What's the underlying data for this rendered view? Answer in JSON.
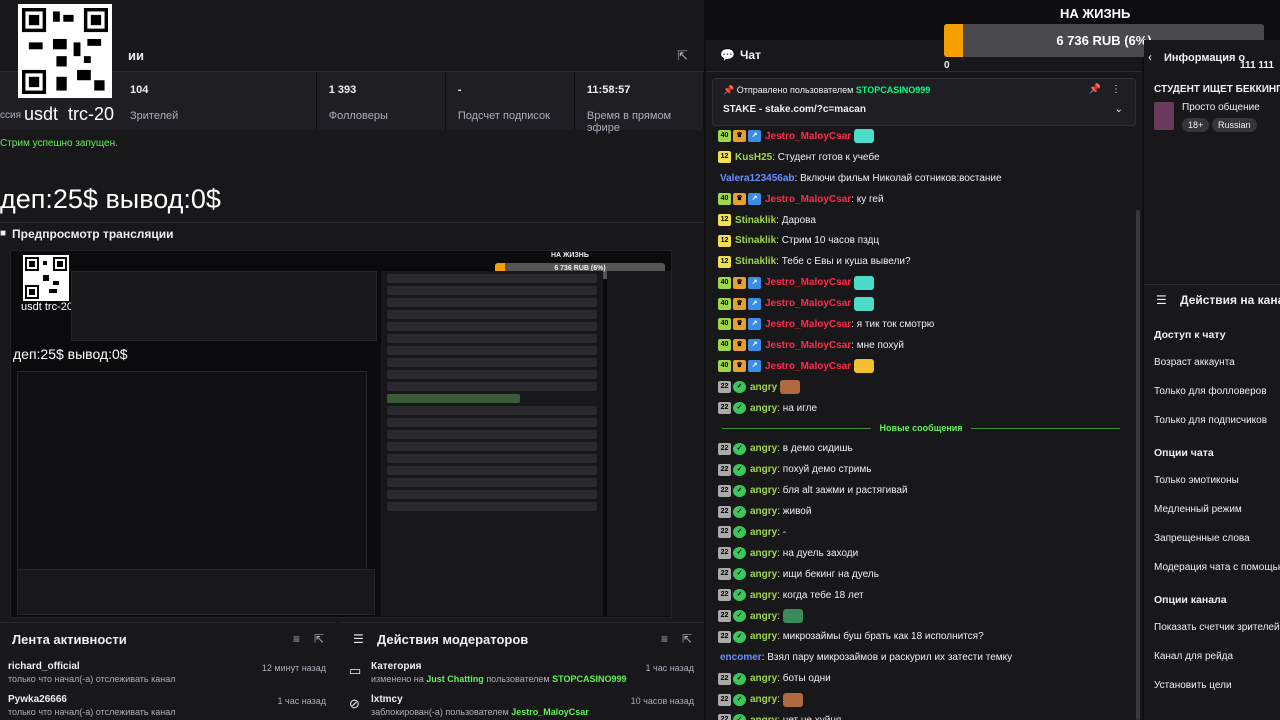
{
  "qr_caption": {
    "left": "usdt",
    "right": "trc-20"
  },
  "stats_header": {
    "title": "ии"
  },
  "stats": [
    {
      "value": "104",
      "label": "Зрителей"
    },
    {
      "value": "1 393",
      "label": "Фолловеры"
    },
    {
      "value": "-",
      "label": "Подсчет подписок"
    },
    {
      "value": "11:58:57",
      "label": "Время в прямом эфире"
    }
  ],
  "status_text": "Стрим успешно запущен.",
  "status_prefix": "ссия",
  "dep_text": "деп:25$ вывод:0$",
  "preview": {
    "title": "Предпросмотр трансляции",
    "goal_title": "НА ЖИЗНЬ",
    "goal_label": "6 736 RUB (6%)",
    "dep_text": "деп:25$ вывод:0$",
    "caption": "usdt  trc-20"
  },
  "activity": {
    "title": "Лента активности",
    "items": [
      {
        "name": "richard_official",
        "desc": "только что начал(-а) отслеживать канал",
        "time": "12 минут назад"
      },
      {
        "name": "Pywka26666",
        "desc": "только что начал(-а) отслеживать канал",
        "time": "1 час назад"
      }
    ]
  },
  "mod_actions_panel": {
    "title": "Действия модераторов",
    "items": [
      {
        "name": "Категория",
        "desc_prefix": "изменено на",
        "category": "Just Chatting",
        "desc_mid": "пользователем",
        "user": "STOPCASINO999",
        "time": "1 час назад"
      },
      {
        "name": "lxtmcy",
        "desc_prefix": "заблокирован(-а) пользователем",
        "category": "",
        "desc_mid": "",
        "user": "Jestro_MaloyCsar",
        "time": "10 часов назад"
      }
    ]
  },
  "chat": {
    "title": "Чат",
    "pinned": {
      "by_prefix": "Отправлено пользователем",
      "by_user": "STOPCASINO999",
      "text": "STAKE - stake.com/?c=macan"
    },
    "new_messages": "Новые сообщения",
    "messages_before": [
      {
        "user": "Jestro_MaloyCsar",
        "color": "#ff2a4a",
        "badges": [
          "40",
          "crown",
          "arr"
        ],
        "text": "",
        "emote": "#4adcc8"
      },
      {
        "user": "KusH25",
        "color": "#9ed64a",
        "badges": [
          "12"
        ],
        "text": ": Студент готов к учебе",
        "emote": ""
      },
      {
        "user": "Valera123456ab",
        "color": "#6a8cff",
        "badges": [],
        "text": ": Включи фильм Николай сотников:востание",
        "emote": ""
      },
      {
        "user": "Jestro_MaloyCsar",
        "color": "#ff2a4a",
        "badges": [
          "40",
          "crown",
          "arr"
        ],
        "text": ": ку гей",
        "emote": ""
      },
      {
        "user": "Stinaklik",
        "color": "#9ed64a",
        "badges": [
          "12"
        ],
        "text": ": Дарова",
        "emote": ""
      },
      {
        "user": "Stinaklik",
        "color": "#9ed64a",
        "badges": [
          "12"
        ],
        "text": ": Стрим 10 часов пздц",
        "emote": ""
      },
      {
        "user": "Stinaklik",
        "color": "#9ed64a",
        "badges": [
          "12"
        ],
        "text": ": Тебе с Евы и куша вывели?",
        "emote": ""
      },
      {
        "user": "Jestro_MaloyCsar",
        "color": "#ff2a4a",
        "badges": [
          "40",
          "crown",
          "arr"
        ],
        "text": "",
        "emote": "#4adcc8"
      },
      {
        "user": "Jestro_MaloyCsar",
        "color": "#ff2a4a",
        "badges": [
          "40",
          "crown",
          "arr"
        ],
        "text": "",
        "emote": "#4adcc8"
      },
      {
        "user": "Jestro_MaloyCsar",
        "color": "#ff2a4a",
        "badges": [
          "40",
          "crown",
          "arr"
        ],
        "text": ": я тик ток смотрю",
        "emote": ""
      },
      {
        "user": "Jestro_MaloyCsar",
        "color": "#ff2a4a",
        "badges": [
          "40",
          "crown",
          "arr"
        ],
        "text": ": мне похуй",
        "emote": ""
      },
      {
        "user": "Jestro_MaloyCsar",
        "color": "#ff2a4a",
        "badges": [
          "40",
          "crown",
          "arr"
        ],
        "text": "",
        "emote": "#f0c030"
      },
      {
        "user": "angry",
        "color": "#9ed64a",
        "badges": [
          "gray",
          "ver"
        ],
        "text": "",
        "emote": "#b06a40"
      },
      {
        "user": "angry",
        "color": "#9ed64a",
        "badges": [
          "gray",
          "ver"
        ],
        "text": ": на игле",
        "emote": ""
      }
    ],
    "messages_after": [
      {
        "user": "angry",
        "color": "#9ed64a",
        "badges": [
          "gray",
          "ver"
        ],
        "text": ": в демо сидишь",
        "emote": ""
      },
      {
        "user": "angry",
        "color": "#9ed64a",
        "badges": [
          "gray",
          "ver"
        ],
        "text": ": похуй демо стримь",
        "emote": ""
      },
      {
        "user": "angry",
        "color": "#9ed64a",
        "badges": [
          "gray",
          "ver"
        ],
        "text": ": бля alt зажми и растягивай",
        "emote": ""
      },
      {
        "user": "angry",
        "color": "#9ed64a",
        "badges": [
          "gray",
          "ver"
        ],
        "text": ": живой",
        "emote": ""
      },
      {
        "user": "angry",
        "color": "#9ed64a",
        "badges": [
          "gray",
          "ver"
        ],
        "text": ": -",
        "emote": ""
      },
      {
        "user": "angry",
        "color": "#9ed64a",
        "badges": [
          "gray",
          "ver"
        ],
        "text": ": на дуель заходи",
        "emote": ""
      },
      {
        "user": "angry",
        "color": "#9ed64a",
        "badges": [
          "gray",
          "ver"
        ],
        "text": ": ищи бекинг на дуель",
        "emote": ""
      },
      {
        "user": "angry",
        "color": "#9ed64a",
        "badges": [
          "gray",
          "ver"
        ],
        "text": ": когда тебе 18 лет",
        "emote": ""
      },
      {
        "user": "angry",
        "color": "#9ed64a",
        "badges": [
          "gray",
          "ver"
        ],
        "text": ":",
        "emote": "#3a8a5a"
      },
      {
        "user": "angry",
        "color": "#9ed64a",
        "badges": [
          "gray",
          "ver"
        ],
        "text": ": микрозаймы буш брать как 18 исполнится?",
        "emote": ""
      },
      {
        "user": "encomer",
        "color": "#6a8cff",
        "badges": [],
        "text": ": Взял пару микрозаймов и раскурил их затести темку",
        "emote": ""
      },
      {
        "user": "angry",
        "color": "#9ed64a",
        "badges": [
          "gray",
          "ver"
        ],
        "text": ": боты одни",
        "emote": ""
      },
      {
        "user": "angry",
        "color": "#9ed64a",
        "badges": [
          "gray",
          "ver"
        ],
        "text": ":",
        "emote": "#b06a40"
      },
      {
        "user": "angry",
        "color": "#9ed64a",
        "badges": [
          "gray",
          "ver"
        ],
        "text": ": нет не хуйня",
        "emote": ""
      }
    ]
  },
  "goal": {
    "title": "НА ЖИЗНЬ",
    "label": "6 736 RUB (6%)",
    "progress": 0.06,
    "min": "0",
    "max": "111 111"
  },
  "info_panel": {
    "title": "Информация о",
    "stream_title": "СТУДЕНТ ИЩЕТ БЕККИНГ",
    "category": "Просто общение",
    "tags": [
      "18+",
      "Russian"
    ]
  },
  "mod_panel": {
    "title": "Действия на кана",
    "sections": [
      {
        "title": "Доступ к чату",
        "options": [
          "Возраст аккаунта",
          "Только для фолловеров",
          "Только для подписчиков"
        ]
      },
      {
        "title": "Опции чата",
        "options": [
          "Только эмотиконы",
          "Медленный режим",
          "Запрещенные слова",
          "Модерация чата с помощью"
        ]
      },
      {
        "title": "Опции канала",
        "options": [
          "Показать счетчик зрителей",
          "Канал для рейда",
          "Установить цели"
        ]
      }
    ]
  },
  "colors": {
    "accent": "#63f05a",
    "goal_fill": "#f5a000",
    "bg": "#0e0e10",
    "panel": "#18181b"
  }
}
